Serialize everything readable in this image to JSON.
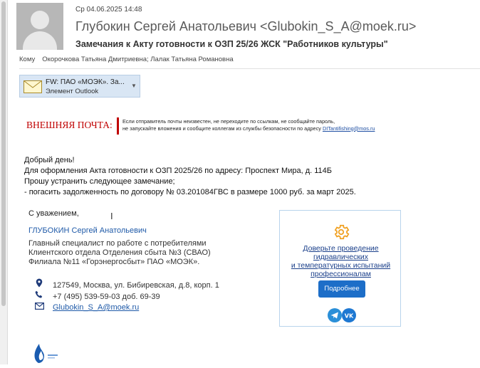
{
  "header": {
    "date": "Ср 04.06.2025 14:48",
    "sender": "Глубокин Сергей Анатольевич <Glubokin_S_A@moek.ru>",
    "subject": "Замечания к Акту готовности к ОЗП 25/26 ЖСК \"Работников культуры\"",
    "to_label": "Кому",
    "to_value": "Окорочкова Татьяна Дмитриевна; Лалак Татьяна Романовна"
  },
  "attachment": {
    "name": "FW: ПАО «МОЭК». За...",
    "type": "Элемент Outlook",
    "icon": "envelope-icon"
  },
  "warning": {
    "label": "ВНЕШНЯЯ ПОЧТА:",
    "line1": "Если отправитель почты неизвестен, не переходите по ссылкам, не сообщайте пароль,",
    "line2": "не запускайте вложения и сообщите коллегам из службы безопасности по адресу",
    "email": "DITantifishing@mos.ru",
    "color": "#c00000"
  },
  "body": {
    "lines": [
      "Добрый день!",
      "Для оформления Акта готовности к ОЗП 2025/26 по адресу: Проспект Мира, д. 114Б",
      "Прошу устранить следующее замечание;",
      "- погасить задолженность по договору № 03.201084ГВС в размере 1000 руб. за март 2025."
    ]
  },
  "signature": {
    "regards": "С уважением,",
    "name": "ГЛУБОКИН Сергей Анатольевич",
    "position": [
      "Главный специалист по работе с потребителями",
      "Клиентского отдела Отделения сбыта №3 (СВАО)",
      "Филиала №11 «Горэнергосбыт» ПАО «МОЭК»."
    ],
    "address": "127549, Москва, ул. Бибиревская, д.8, корп. 1",
    "phone": "+7 (495) 539-59-03 доб. 69-39",
    "email": "Glubokin_S_A@moek.ru"
  },
  "promo": {
    "link": "Доверьте проведение гидравлических и температурных испытаний профессионалам",
    "link_lines": [
      "Доверьте проведение",
      "гидравлических",
      "и температурных испытаний",
      "профессионалам"
    ],
    "button": "Подробнее",
    "socials": [
      "telegram-icon",
      "vk-icon"
    ]
  }
}
